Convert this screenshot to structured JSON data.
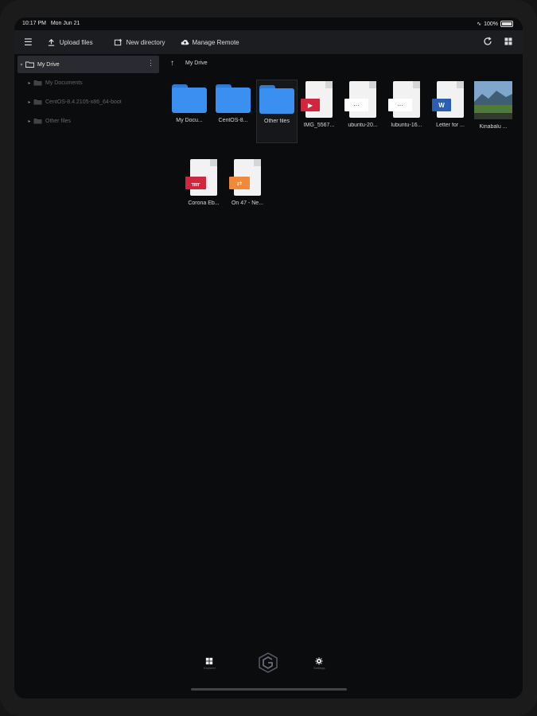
{
  "status": {
    "time": "10:17 PM",
    "date": "Mon Jun 21",
    "battery": "100%"
  },
  "toolbar": {
    "upload_label": "Upload files",
    "new_dir_label": "New directory",
    "manage_remote_label": "Manage Remote"
  },
  "sidebar": {
    "items": [
      {
        "label": "My Drive",
        "selected": true
      },
      {
        "label": "My Documents"
      },
      {
        "label": "CentOS-8.4.2105-x86_64-boot"
      },
      {
        "label": "Other files"
      }
    ]
  },
  "breadcrumb": {
    "path": "My Drive"
  },
  "files": [
    {
      "label": "My Docu...",
      "kind": "folder"
    },
    {
      "label": "CentOS-8...",
      "kind": "folder"
    },
    {
      "label": "Other files",
      "kind": "folder"
    },
    {
      "label": "IMG_5567...",
      "kind": "video"
    },
    {
      "label": "ubuntu-20...",
      "kind": "generic"
    },
    {
      "label": "lubuntu-16...",
      "kind": "generic"
    },
    {
      "label": "Letter for ...",
      "kind": "word"
    },
    {
      "label": "Kinabalu ...",
      "kind": "image"
    },
    {
      "label": "Corona Eb...",
      "kind": "pdf"
    },
    {
      "label": "On 47 - Ne...",
      "kind": "audio"
    }
  ],
  "bottom_nav": {
    "items": [
      {
        "label": "Explorer"
      },
      {
        "label": ""
      },
      {
        "label": "Settings"
      }
    ]
  },
  "colors": {
    "folder": "#3b8ff0",
    "accent_red": "#d0273f",
    "word_blue": "#2b5fb4",
    "audio_orange": "#f08a3a"
  },
  "icons": {
    "menu": "hamburger-icon",
    "upload": "upload-icon",
    "new_dir": "new-folder-icon",
    "cloud": "cloud-icon",
    "refresh": "refresh-icon",
    "grid": "grid-view-icon",
    "up": "up-arrow-icon",
    "settings": "gear-icon"
  }
}
